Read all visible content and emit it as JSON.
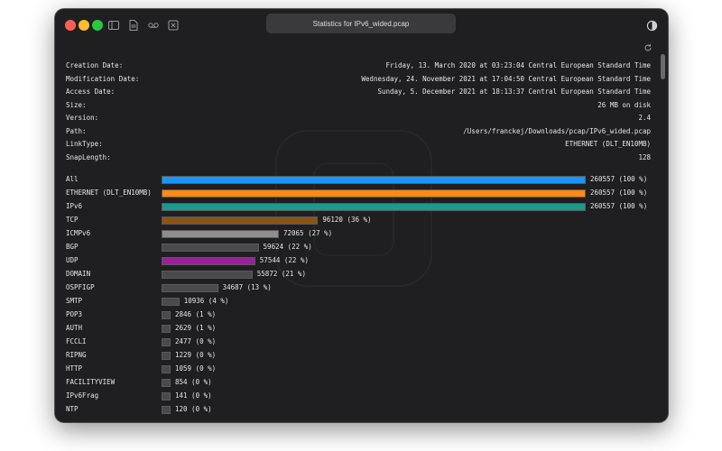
{
  "window": {
    "title": "Statistics for IPv6_wided.pcap"
  },
  "info": [
    {
      "label": "Creation Date:",
      "value": "Friday, 13. March 2020 at 03:23:04 Central European Standard Time"
    },
    {
      "label": "Modification Date:",
      "value": "Wednesday, 24. November 2021 at 17:04:50 Central European Standard Time"
    },
    {
      "label": "Access Date:",
      "value": "Sunday, 5. December 2021 at 18:13:37 Central European Standard Time"
    },
    {
      "label": "Size:",
      "value": "26 MB on disk"
    },
    {
      "label": "Version:",
      "value": "2.4"
    },
    {
      "label": "Path:",
      "value": "/Users/franckej/Downloads/pcap/IPv6_wided.pcap"
    },
    {
      "label": "LinkType:",
      "value": "ETHERNET (DLT_EN10MB)"
    },
    {
      "label": "SnapLength:",
      "value": "128"
    }
  ],
  "stats_total": 260557,
  "stats": [
    {
      "label": "All",
      "value": "260557 (100 %)",
      "count": 260557,
      "color": "#1a95ff"
    },
    {
      "label": "ETHERNET (DLT_EN10MB)",
      "value": "260557 (100 %)",
      "count": 260557,
      "color": "#ff8a14"
    },
    {
      "label": "IPv6",
      "value": "260557 (100 %)",
      "count": 260557,
      "color": "#1b9a8e"
    },
    {
      "label": "TCP",
      "value": "96120 (36 %)",
      "count": 96120,
      "color": "#8a5414"
    },
    {
      "label": "ICMPv6",
      "value": "72065 (27 %)",
      "count": 72065,
      "color": "#8e8e8e"
    },
    {
      "label": "BGP",
      "value": "59624 (22 %)",
      "count": 59624,
      "color": "#4a4a4c"
    },
    {
      "label": "UDP",
      "value": "57544 (22 %)",
      "count": 57544,
      "color": "#9a1f9a"
    },
    {
      "label": "DOMAIN",
      "value": "55872 (21 %)",
      "count": 55872,
      "color": "#4a4a4c"
    },
    {
      "label": "OSPFIGP",
      "value": "34687 (13 %)",
      "count": 34687,
      "color": "#4a4a4c"
    },
    {
      "label": "SMTP",
      "value": "10936 (4 %)",
      "count": 10936,
      "color": "#4a4a4c"
    },
    {
      "label": "POP3",
      "value": "2846 (1 %)",
      "count": 2846,
      "color": "#4a4a4c"
    },
    {
      "label": "AUTH",
      "value": "2629 (1 %)",
      "count": 2629,
      "color": "#4a4a4c"
    },
    {
      "label": "FCCLI",
      "value": "2477 (0 %)",
      "count": 2477,
      "color": "#4a4a4c"
    },
    {
      "label": "RIPNG",
      "value": "1229 (0 %)",
      "count": 1229,
      "color": "#4a4a4c"
    },
    {
      "label": "HTTP",
      "value": "1059 (0 %)",
      "count": 1059,
      "color": "#4a4a4c"
    },
    {
      "label": "FACILITYVIEW",
      "value": "854 (0 %)",
      "count": 854,
      "color": "#4a4a4c"
    },
    {
      "label": "IPv6Frag",
      "value": "141 (0 %)",
      "count": 141,
      "color": "#4a4a4c"
    },
    {
      "label": "NTP",
      "value": "120 (0 %)",
      "count": 120,
      "color": "#4a4a4c"
    }
  ]
}
